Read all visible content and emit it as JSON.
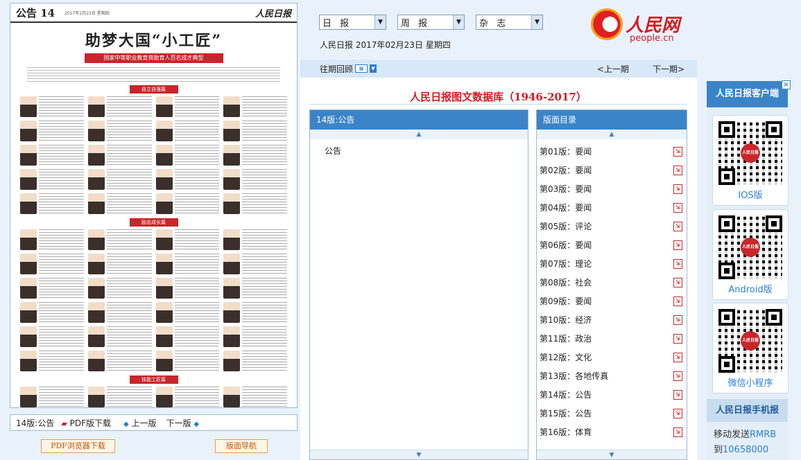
{
  "paper": {
    "page_name": "公告 14",
    "date_small": "2017年2月23日 星期四",
    "logo_text": "人民日报",
    "headline": "助梦大国“小工匠”",
    "subhead": "国家中等职业教育资助育人百名成才典型",
    "sections": [
      "自立自强篇",
      "励志成长篇",
      "技能工匠篇"
    ]
  },
  "paper_toolbar": {
    "current_page": "14版:公告",
    "pdf_download": "PDF版下载",
    "prev_page": "上一版",
    "next_page": "下一版"
  },
  "bottom_buttons": {
    "pdf_browser": "PDF浏览器下载",
    "layout_nav": "版面导航"
  },
  "header": {
    "select_daily": "日 报",
    "select_weekly": "周 报",
    "select_magazine": "杂 志",
    "date_line": "人民日报 2017年02月23日 星期四",
    "logo_cn": "人民网",
    "logo_en": "people.cn"
  },
  "nav": {
    "history_label": "往期回顾",
    "prev_issue": "<上一期",
    "next_issue": "下一期>"
  },
  "db_title": "人民日报图文数据库（1946-2017）",
  "left_panel": {
    "header": "14版:公告",
    "items": [
      "公告"
    ]
  },
  "right_panel": {
    "header": "版面目录",
    "pages": [
      "第01版：要闻",
      "第02版：要闻",
      "第03版：要闻",
      "第04版：要闻",
      "第05版：评论",
      "第06版：要闻",
      "第07版：理论",
      "第08版：社会",
      "第09版：要闻",
      "第10版：经济",
      "第11版：政治",
      "第12版：文化",
      "第13版：各地传真",
      "第14版：公告",
      "第15版：公告",
      "第16版：体育"
    ]
  },
  "sidebar": {
    "title": "人民日报客户端",
    "close": "×",
    "qr_cards": [
      {
        "label": "IOS版",
        "seal": "人民日报"
      },
      {
        "label": "Android版",
        "seal": "人民日报"
      },
      {
        "label": "微信小程序",
        "seal": "人民日报"
      }
    ],
    "mobile_title": "人民日报手机报",
    "sms_line1_a": "移动发送",
    "sms_line1_b": "RMRB",
    "sms_line2_a": "到",
    "sms_line2_b": "10658000"
  }
}
